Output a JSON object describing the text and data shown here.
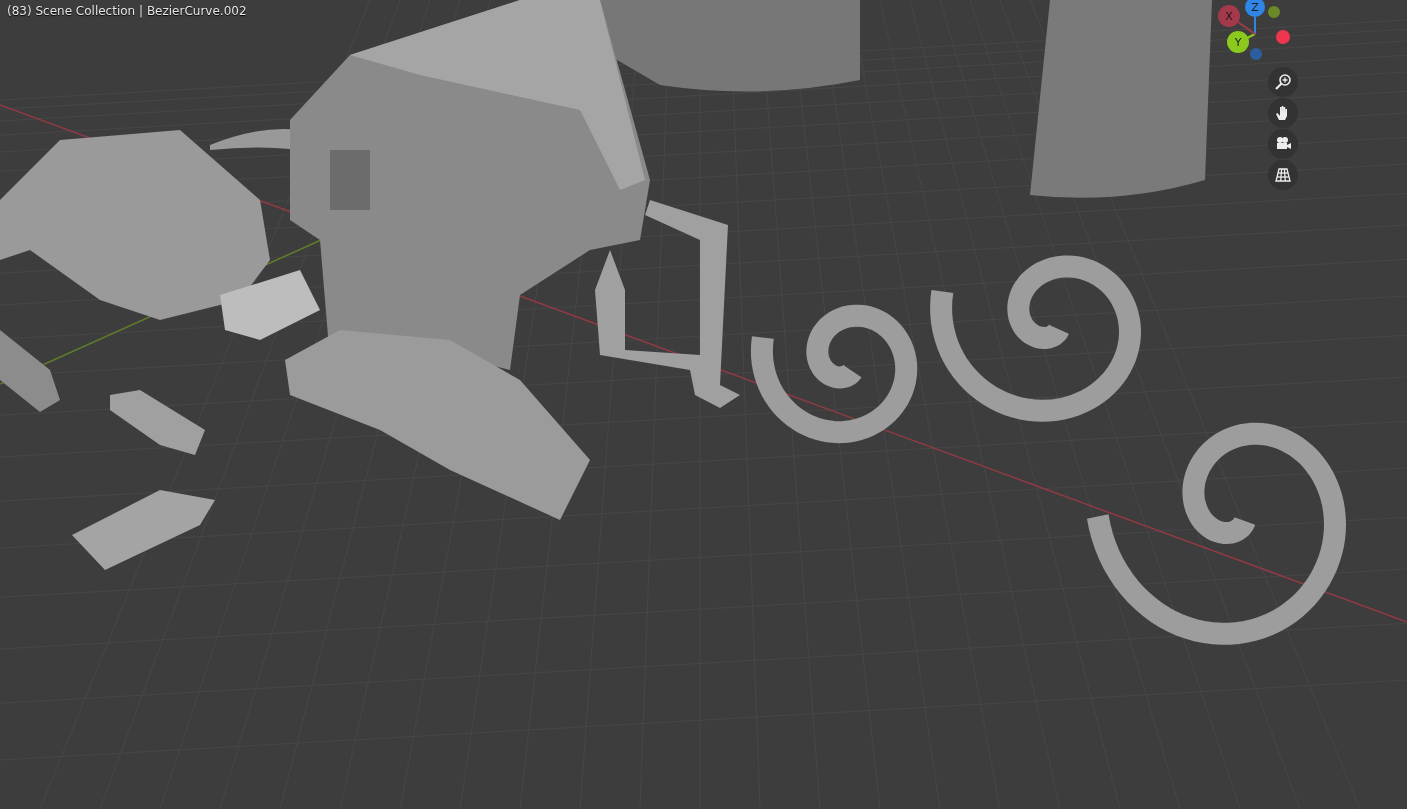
{
  "viewport": {
    "header": "(83) Scene Collection | BezierCurve.002"
  },
  "gizmo": {
    "axes": [
      {
        "label": "X",
        "color": "#a3394a"
      },
      {
        "label": "Y",
        "color": "#8bc91c"
      },
      {
        "label": "Z",
        "color": "#2f86e6"
      }
    ],
    "negative_axes": [
      {
        "color": "#6a8a2a"
      },
      {
        "color": "#f0364f"
      },
      {
        "color": "#2d5fa0"
      }
    ]
  },
  "navigation": [
    {
      "kind": "zoom"
    },
    {
      "kind": "pan"
    },
    {
      "kind": "camera"
    },
    {
      "kind": "perspective"
    }
  ]
}
